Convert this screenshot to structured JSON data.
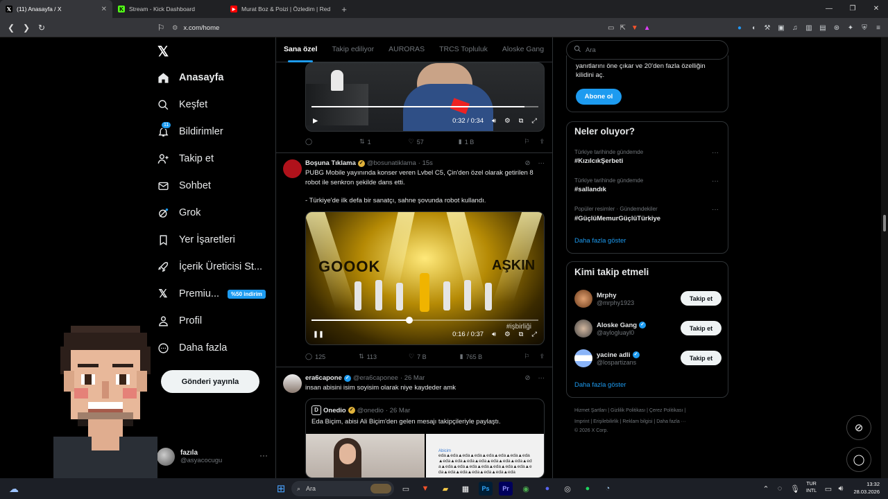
{
  "browser": {
    "tabs": [
      {
        "title": "(11) Anasayfa / X",
        "active": true,
        "favicon": "x-icon"
      },
      {
        "title": "Stream - Kick Dashboard",
        "active": false,
        "favicon": "kick-icon"
      },
      {
        "title": "Murat Boz & Poizi | Özledim | Red Bu",
        "active": false,
        "favicon": "youtube-icon"
      }
    ],
    "url": "x.com/home"
  },
  "sidebar": {
    "items": [
      {
        "label": "Anasayfa",
        "icon": "home-icon"
      },
      {
        "label": "Keşfet",
        "icon": "search-icon"
      },
      {
        "label": "Bildirimler",
        "icon": "bell-icon",
        "badge": "11"
      },
      {
        "label": "Takip et",
        "icon": "add-user-icon"
      },
      {
        "label": "Sohbet",
        "icon": "mail-icon"
      },
      {
        "label": "Grok",
        "icon": "grok-icon"
      },
      {
        "label": "Yer İşaretleri",
        "icon": "bookmark-icon"
      },
      {
        "label": "İçerik Üreticisi St...",
        "icon": "rocket-icon"
      },
      {
        "label": "Premiu...",
        "icon": "x-icon",
        "promo": "%50 indirim"
      },
      {
        "label": "Profil",
        "icon": "user-icon"
      },
      {
        "label": "Daha fazla",
        "icon": "more-icon"
      }
    ],
    "post_button": "Gönderi yayınla",
    "account": {
      "name": "fazıla",
      "handle": "@asyacocugu"
    }
  },
  "feed": {
    "tabs": [
      "Sana özel",
      "Takip ediliyor",
      "AURORAS",
      "TRCS Topluluk",
      "Aloske Gang"
    ],
    "tweet1": {
      "video_time": "0:32 / 0:34",
      "progress": 0.94,
      "stats": {
        "replies": "",
        "reposts": "1",
        "likes": "57",
        "views": "1 B"
      }
    },
    "tweet2": {
      "name": "Boşuna Tıklama",
      "handle": "@bosunatiklama",
      "time": "· 15s",
      "text1": "PUBG Mobile yayınında konser veren Lvbel C5, Çin'den özel olarak getirilen 8 robot ile senkron şekilde dans etti.",
      "text2": "- Türkiye'de ilk defa bir sanatçı, sahne şovunda robot kullandı.",
      "video_time": "0:16 / 0:37",
      "progress": 0.43,
      "overlay_left": "GOOOK",
      "overlay_right": "AŞKIN",
      "watermark": "#işbirliği",
      "stats": {
        "replies": "125",
        "reposts": "113",
        "likes": "7 B",
        "views": "765 B"
      }
    },
    "tweet3": {
      "name": "era6capone",
      "handle": "@era6caponee",
      "time": "· 26 Mar",
      "text": "insan abisini isim soyisim olarak niye kaydeder amk",
      "quote": {
        "name": "Onedio",
        "handle": "@onedio",
        "time": "· 26 Mar",
        "text": "Eda Biçim, abisi Ali Biçim'den gelen mesajı takipçileriyle paylaştı.",
        "chat_name": "Abicim",
        "chat_text": "eda▲eda▲eda▲eda▲eda▲eda▲eda▲eda▲eda▲eda▲eda▲eda▲eda▲eda▲eda▲eda▲eda▲eda▲eda▲eda▲eda▲eda▲eda▲eda▲eda▲eda▲eda▲eda▲eda▲eda"
      }
    }
  },
  "right": {
    "search_placeholder": "Ara",
    "premium_text": "yanıtlarını öne çıkar ve 20'den fazla özelliğin kilidini aç.",
    "subscribe_button": "Abone ol",
    "trends_title": "Neler oluyor?",
    "trends": [
      {
        "meta": "Türkiye tarihinde gündemde",
        "name": "#KızılcıkŞerbeti"
      },
      {
        "meta": "Türkiye tarihinde gündemde",
        "name": "#sallandık"
      },
      {
        "meta": "Popüler resimler · Gündemdekiler",
        "name": "#GüçlüMemurGüçlüTürkiye"
      }
    ],
    "show_more": "Daha fazla göster",
    "who_title": "Kimi takip etmeli",
    "who": [
      {
        "name": "Mrphy",
        "handle": "@mrphy1923",
        "verified": false
      },
      {
        "name": "Aloske Gang",
        "handle": "@aylogluayl0",
        "verified": true
      },
      {
        "name": "yacine adli",
        "handle": "@lospartizans",
        "verified": true
      }
    ],
    "follow_label": "Takip et",
    "footer1": "Hizmet Şartları  |   Gizlilik Politikası  |   Çerez Politikası  |",
    "footer2": "Imprint  |   Erişilebilirlik  |   Reklam bilgisi  |   Daha fazla ···",
    "footer3": "© 2026 X Corp."
  },
  "taskbar": {
    "search": "Ara",
    "lang": "TUR",
    "lang2": "INTL",
    "time": "13:32",
    "date": "28.03.2026"
  },
  "colors": {
    "accent": "#1d9bf0",
    "bg": "#000000",
    "text": "#e7e9ea",
    "muted": "#71767b"
  }
}
